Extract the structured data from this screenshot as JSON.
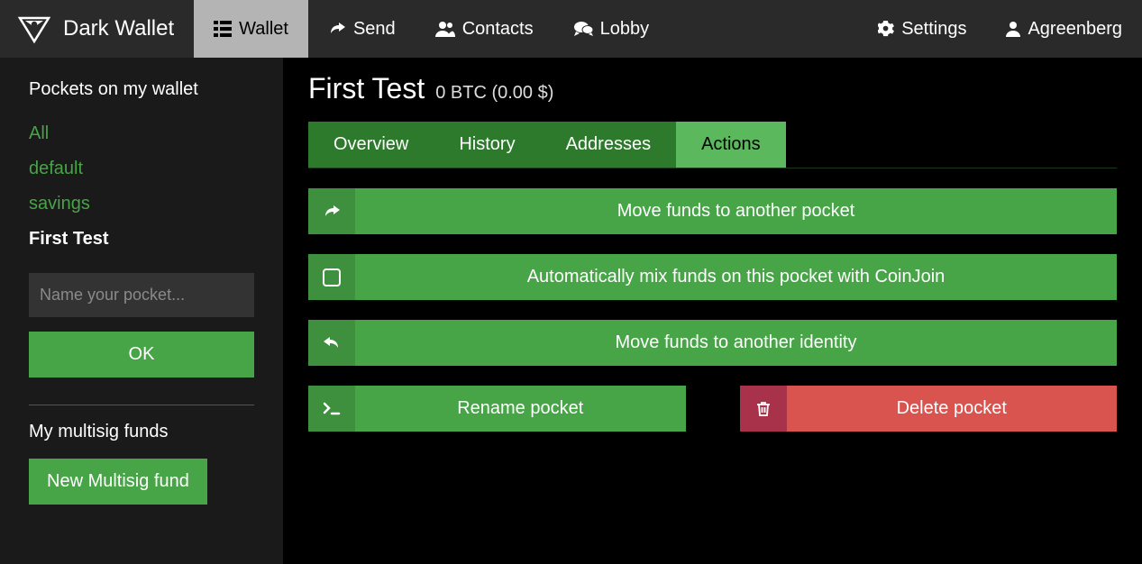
{
  "brand": "Dark Wallet",
  "nav": {
    "wallet": "Wallet",
    "send": "Send",
    "contacts": "Contacts",
    "lobby": "Lobby",
    "settings": "Settings",
    "user": "Agreenberg"
  },
  "sidebar": {
    "pockets_header": "Pockets on my wallet",
    "pockets": {
      "0": "All",
      "1": "default",
      "2": "savings",
      "3": "First Test"
    },
    "name_placeholder": "Name your pocket...",
    "ok_label": "OK",
    "multisig_header": "My multisig funds",
    "new_multisig_label": "New Multisig fund"
  },
  "main": {
    "title": "First Test",
    "balance": "0 BTC (0.00 $)",
    "tabs": {
      "overview": "Overview",
      "history": "History",
      "addresses": "Addresses",
      "actions": "Actions"
    },
    "actions": {
      "move_pocket": "Move funds to another pocket",
      "coinjoin": "Automatically mix funds on this pocket with CoinJoin",
      "move_identity": "Move funds to another identity",
      "rename": "Rename pocket",
      "delete": "Delete pocket"
    }
  }
}
